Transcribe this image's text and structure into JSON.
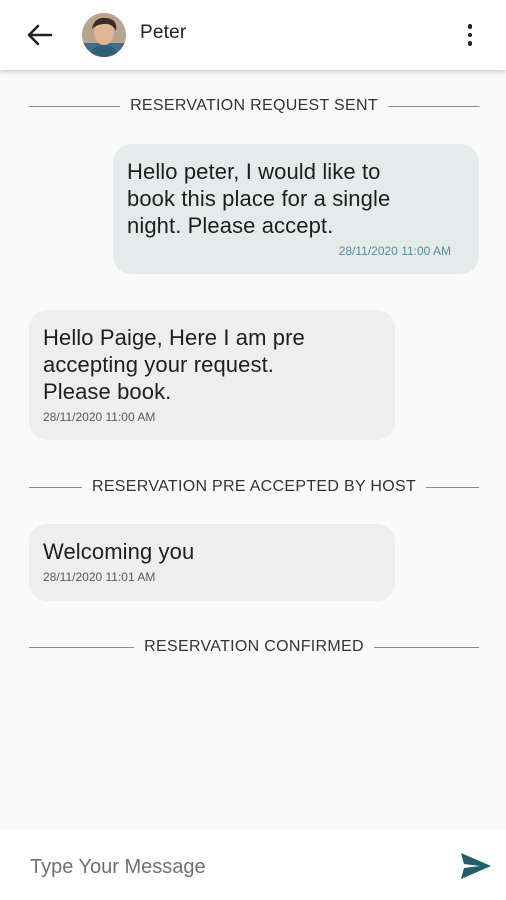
{
  "header": {
    "contact_name": "Peter"
  },
  "dividers": [
    "RESERVATION REQUEST SENT",
    "RESERVATION PRE ACCEPTED BY HOST",
    "RESERVATION CONFIRMED"
  ],
  "messages": [
    {
      "direction": "sent",
      "lines": [
        "Hello peter, I would like to",
        "book this place for a single",
        "night. Please accept."
      ],
      "time": "28/11/2020 11:00 AM"
    },
    {
      "direction": "received",
      "lines": [
        "Hello Paige, Here I am pre",
        "accepting your request.",
        "Please book."
      ],
      "time": "28/11/2020 11:00 AM"
    },
    {
      "direction": "received",
      "lines": [
        "Welcoming you"
      ],
      "time": "28/11/2020 11:01 AM"
    }
  ],
  "composer": {
    "placeholder": "Type Your Message",
    "value": ""
  },
  "icons": {
    "back": "arrow-back-icon",
    "menu": "more-vert-icon",
    "send": "send-icon"
  },
  "colors": {
    "sent_bubble": "#e5ebeb",
    "received_bubble": "#eeeeee",
    "send_icon": "#1f5f6b",
    "sent_timestamp": "#5e8c93"
  }
}
